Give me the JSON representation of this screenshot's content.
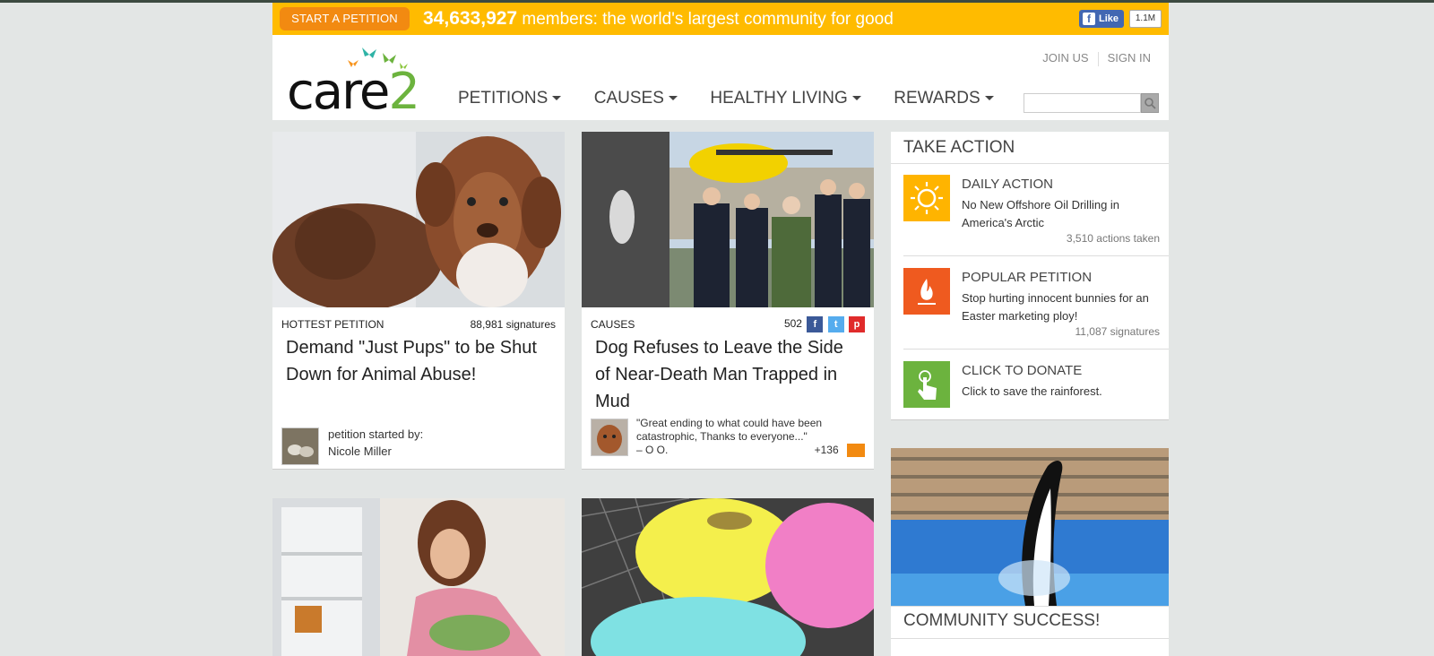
{
  "promo": {
    "start_label": "START A PETITION",
    "member_count": "34,633,927",
    "tagline": "members: the world's largest community for good",
    "like_label": "Like",
    "like_count": "1.1M"
  },
  "header": {
    "logo": "care2",
    "top_links": [
      "JOIN US",
      "SIGN IN"
    ],
    "nav": [
      "PETITIONS",
      "CAUSES",
      "HEALTHY LIVING",
      "REWARDS"
    ],
    "search_placeholder": ""
  },
  "cards": [
    {
      "category": "HOTTEST PETITION",
      "count": "88,981 signatures",
      "title": "Demand \"Just Pups\" to be Shut Down for Animal Abuse!",
      "byline_label": "petition started by:",
      "byline_name": "Nicole Miller"
    },
    {
      "category": "CAUSES",
      "count": "502",
      "title": "Dog Refuses to Leave the Side of Near-Death Man Trapped in Mud",
      "quote": "\"Great ending to what could have been catastrophic, Thanks to everyone...\"",
      "quote_author": "– O O.",
      "comment_count": "+136"
    }
  ],
  "sidebar": {
    "heading": "TAKE ACTION",
    "items": [
      {
        "kind": "DAILY ACTION",
        "text": "No New Offshore Oil Drilling in America's Arctic",
        "count": "3,510 actions taken",
        "icon": "sun-icon",
        "color": "#ffb400"
      },
      {
        "kind": "POPULAR PETITION",
        "text": "Stop hurting innocent bunnies for an Easter marketing ploy!",
        "count": "11,087 signatures",
        "icon": "flame-icon",
        "color": "#ef5a1f"
      },
      {
        "kind": "CLICK TO DONATE",
        "text": "Click to save the rainforest.",
        "icon": "hand-pointer-icon",
        "color": "#6cb33e"
      }
    ]
  },
  "community": {
    "title": "COMMUNITY SUCCESS!"
  },
  "colors": {
    "promo_bar": "#ffbb00",
    "start_button": "#f28a11",
    "brand_green": "#6cb33e"
  }
}
